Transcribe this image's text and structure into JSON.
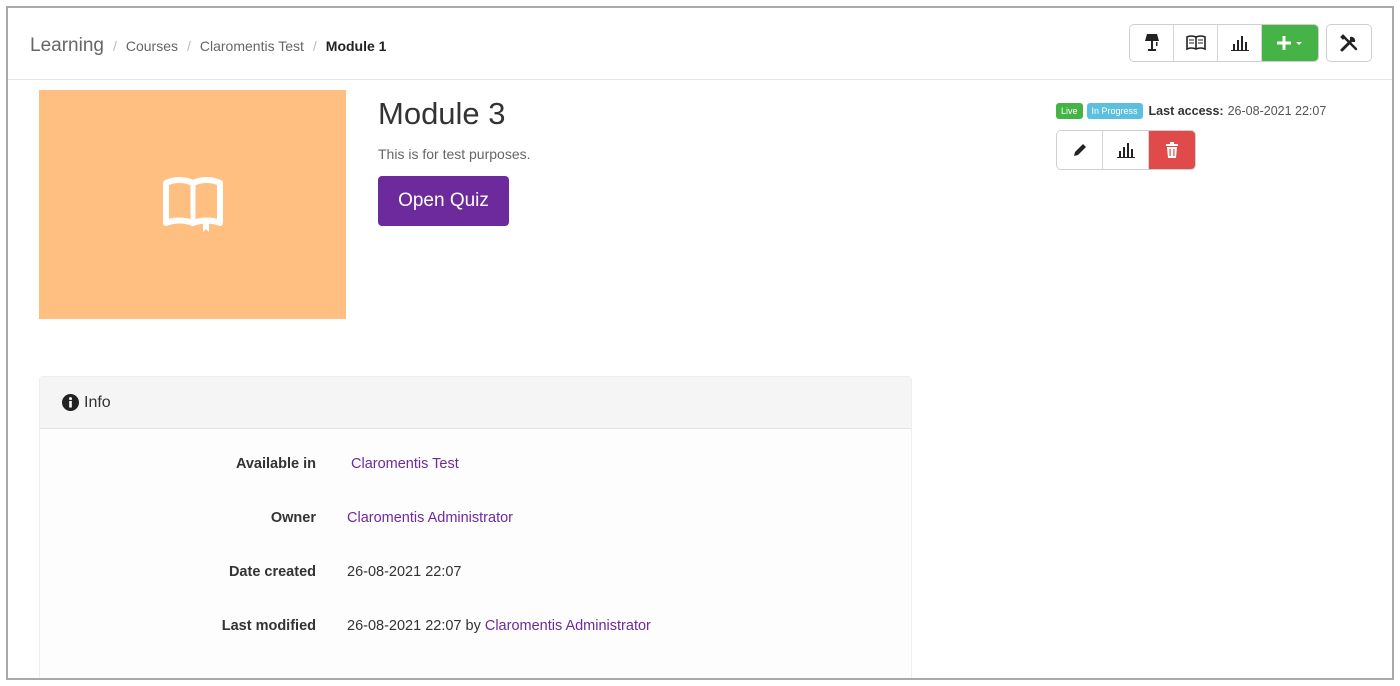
{
  "breadcrumb": {
    "root": "Learning",
    "items": [
      "Courses",
      "Claromentis Test"
    ],
    "current": "Module 1"
  },
  "toolbar": {
    "icons": [
      "lamp-icon",
      "book-open-icon",
      "bar-chart-icon",
      "plus-icon",
      "tools-icon"
    ],
    "add_label": "+",
    "accent_green": "#46b347"
  },
  "module": {
    "title": "Module 3",
    "description": "This is for test purposes.",
    "open_quiz_label": "Open Quiz",
    "thumbnail_color": "#ffbf80",
    "button_color": "#6d2a9c"
  },
  "status": {
    "live_label": "Live",
    "progress_label": "In Progress",
    "last_access_label": "Last access:",
    "last_access_value": "26-08-2021 22:07"
  },
  "actions": {
    "icons": [
      "pencil-icon",
      "bar-chart-icon",
      "trash-icon"
    ],
    "delete_color": "#e04a4a"
  },
  "info": {
    "heading": "Info",
    "available_in_label": "Available in",
    "available_in_value": "Claromentis Test",
    "owner_label": "Owner",
    "owner_value": "Claromentis Administrator",
    "date_created_label": "Date created",
    "date_created_value": "26-08-2021 22:07",
    "last_modified_label": "Last modified",
    "last_modified_value": "26-08-2021 22:07 by",
    "last_modified_by": "Claromentis Administrator"
  }
}
